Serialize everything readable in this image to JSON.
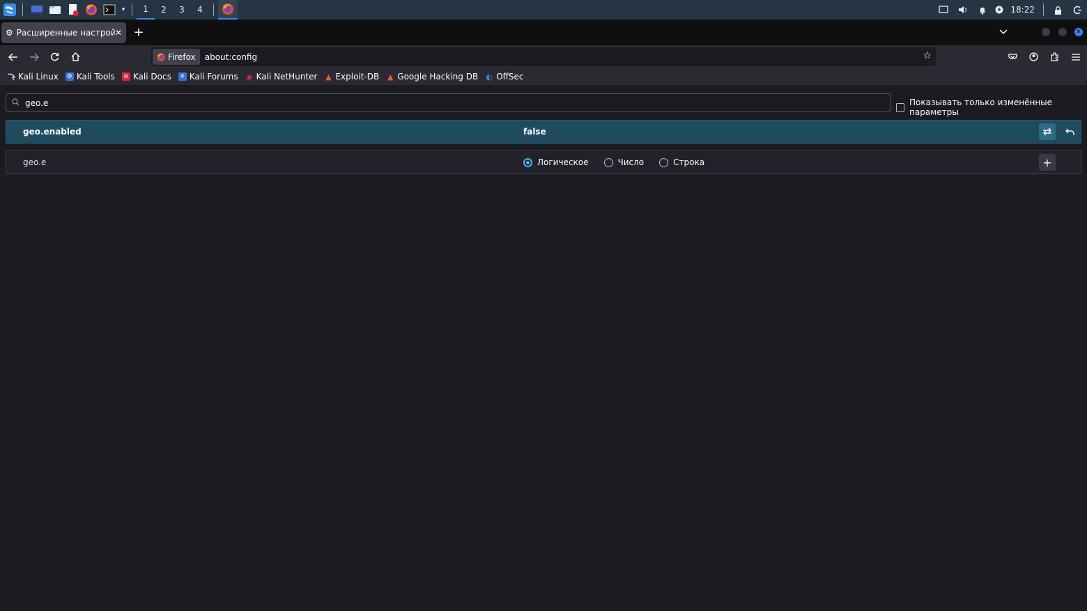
{
  "taskbar": {
    "workspaces": [
      "1",
      "2",
      "3",
      "4"
    ],
    "clock": "18:22"
  },
  "tab": {
    "title": "Расширенные настройки"
  },
  "urlbar": {
    "identity_label": "Firefox",
    "url": "about:config"
  },
  "bookmarks": [
    {
      "label": "Kali Linux",
      "color": "#8fa3b6"
    },
    {
      "label": "Kali Tools",
      "color": "#3b6fd6"
    },
    {
      "label": "Kali Docs",
      "color": "#d7263d"
    },
    {
      "label": "Kali Forums",
      "color": "#3b6fd6"
    },
    {
      "label": "Kali NetHunter",
      "color": "#d7263d"
    },
    {
      "label": "Exploit-DB",
      "color": "#e0622c"
    },
    {
      "label": "Google Hacking DB",
      "color": "#e0622c"
    },
    {
      "label": "OffSec",
      "color": "#4f7ce0"
    }
  ],
  "config": {
    "search_value": "geo.e",
    "show_modified_label": "Показывать только изменённые параметры",
    "rows": [
      {
        "name": "geo.enabled",
        "value": "false"
      },
      {
        "name": "geo.e"
      }
    ],
    "types": [
      "Логическое",
      "Число",
      "Строка"
    ],
    "selected_type": "Логическое"
  }
}
